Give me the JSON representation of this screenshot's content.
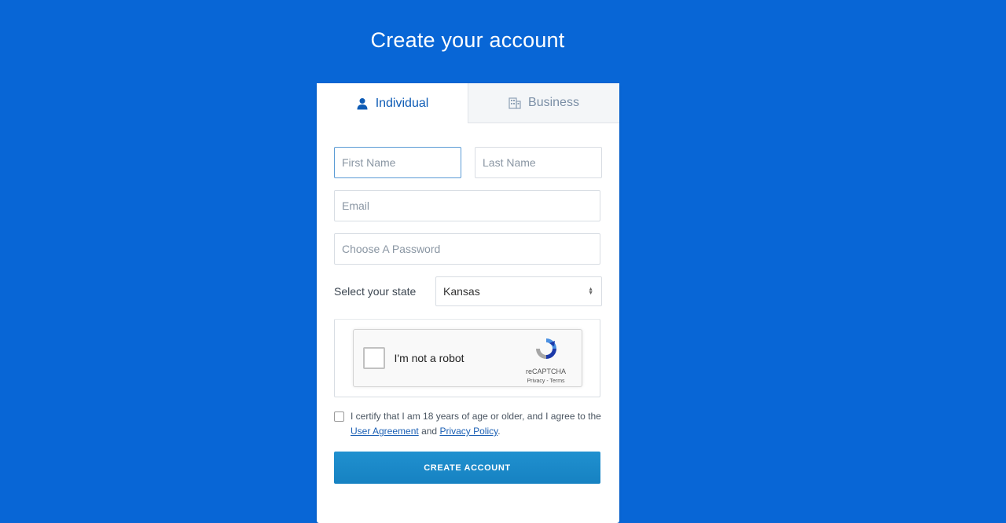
{
  "page": {
    "title": "Create your account"
  },
  "tabs": [
    {
      "label": "Individual",
      "icon": "user-icon",
      "active": true
    },
    {
      "label": "Business",
      "icon": "building-icon",
      "active": false
    }
  ],
  "form": {
    "first_name_placeholder": "First Name",
    "last_name_placeholder": "Last Name",
    "email_placeholder": "Email",
    "password_placeholder": "Choose A Password",
    "state_label": "Select your state",
    "state_value": "Kansas"
  },
  "captcha": {
    "label": "I'm not a robot",
    "brand": "reCAPTCHA",
    "privacy": "Privacy",
    "separator": " - ",
    "terms": "Terms"
  },
  "certify": {
    "text": "I certify that I am 18 years of age or older, and I agree to the",
    "agreement_link": "User Agreement",
    "and": "and",
    "privacy_link": "Privacy Policy",
    "period": "."
  },
  "submit_label": "CREATE ACCOUNT",
  "colors": {
    "background": "#0866d6",
    "accent": "#0d5bb5",
    "button": "#1682c2"
  }
}
